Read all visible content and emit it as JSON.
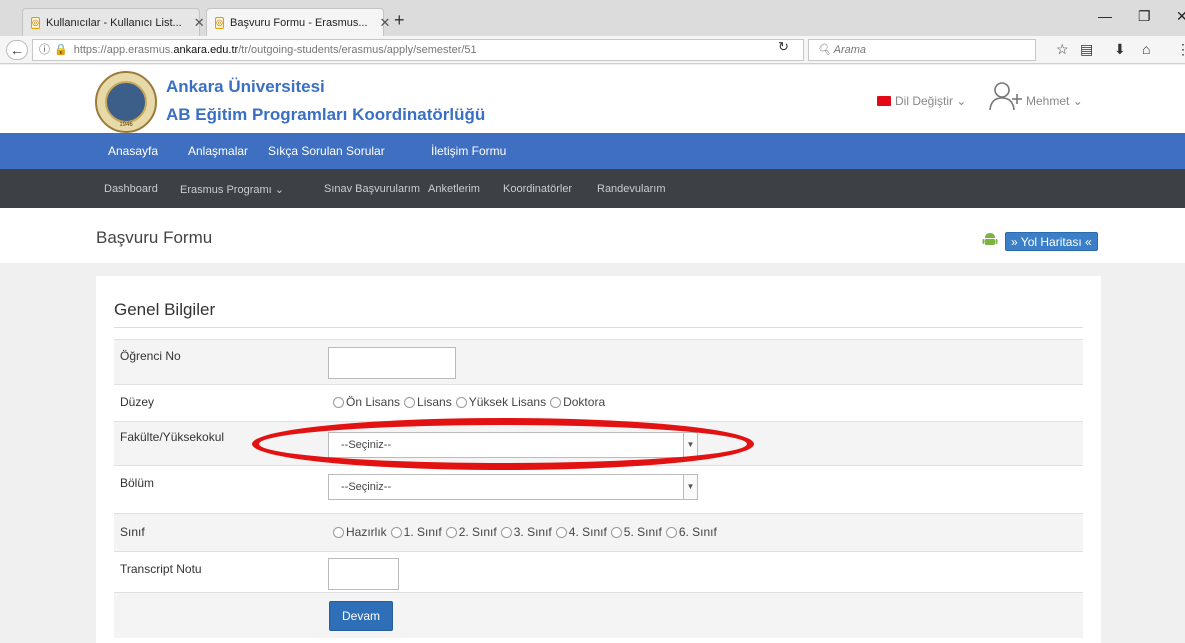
{
  "browser": {
    "tabs": [
      {
        "title": "Kullanıcılar - Kullanıcı List...",
        "active": false
      },
      {
        "title": "Başvuru Formu - Erasmus...",
        "active": true
      }
    ],
    "url_prefix": "https://app.erasmus.",
    "url_domain": "ankara.edu.tr",
    "url_path": "/tr/outgoing-students/erasmus/apply/semester/51",
    "search_placeholder": "Arama"
  },
  "header": {
    "org_line1": "Ankara Üniversitesi",
    "org_line2": "AB Eğitim Programları Koordinatörlüğü",
    "logo_year": "1946",
    "language": "Dil Değiştir",
    "user": "Mehmet"
  },
  "menu_primary": [
    "Anasayfa",
    "Anlaşmalar",
    "Sıkça Sorulan Sorular",
    "İletişim Formu"
  ],
  "menu_secondary": [
    "Dashboard",
    "Erasmus Programı",
    "Sınav Başvurularım",
    "Anketlerim",
    "Koordinatörler",
    "Randevularım"
  ],
  "page": {
    "title": "Başvuru Formu",
    "roadmap": "» Yol Haritası «"
  },
  "form": {
    "section": "Genel Bilgiler",
    "fields": {
      "student_no": {
        "label": "Öğrenci No",
        "value": ""
      },
      "level": {
        "label": "Düzey",
        "options": [
          "Ön Lisans",
          "Lisans",
          "Yüksek Lisans",
          "Doktora"
        ]
      },
      "faculty": {
        "label": "Fakülte/Yüksekokul",
        "selected": "--Seçiniz--"
      },
      "department": {
        "label": "Bölüm",
        "selected": "--Seçiniz--"
      },
      "class": {
        "label": "Sınıf",
        "options": [
          "Hazırlık",
          "1. Sınıf",
          "2. Sınıf",
          "3. Sınıf",
          "4. Sınıf",
          "5. Sınıf",
          "6. Sınıf"
        ]
      },
      "transcript": {
        "label": "Transcript Notu",
        "value": ""
      }
    },
    "submit": "Devam"
  },
  "colors": {
    "primary_menu": "#3f6fc0",
    "secondary_menu": "#3d4045",
    "button": "#2f6fb7",
    "highlight": "#e31212"
  }
}
